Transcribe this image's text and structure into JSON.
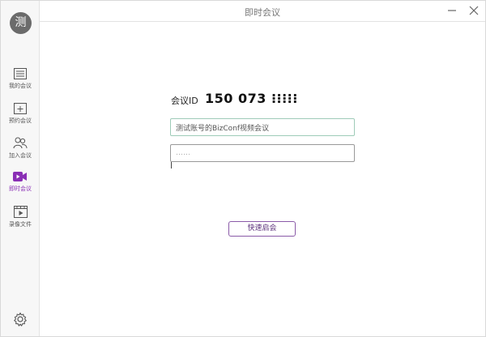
{
  "sidebar": {
    "avatar_text": "测",
    "items": [
      {
        "label": "我的会议",
        "icon": "list-icon"
      },
      {
        "label": "预约会议",
        "icon": "calendar-plus-icon"
      },
      {
        "label": "加入会议",
        "icon": "users-icon"
      },
      {
        "label": "即时会议",
        "icon": "video-icon",
        "active": true
      },
      {
        "label": "录像文件",
        "icon": "recording-icon"
      }
    ],
    "settings_icon": "gear-icon"
  },
  "window": {
    "title": "即时会议",
    "minimize_icon": "minimize-icon",
    "close_icon": "close-icon"
  },
  "meeting": {
    "id_label": "会议ID",
    "id_value": "150 073 ⁝⁝⁝⁝⁝",
    "topic_value": "测试账号的BizConf视频会议",
    "password_value": "……",
    "start_label": "快速启会"
  },
  "colors": {
    "accent": "#8a2fb5",
    "button_border": "#8a5aa8",
    "focus_border": "#9ecbb8"
  }
}
